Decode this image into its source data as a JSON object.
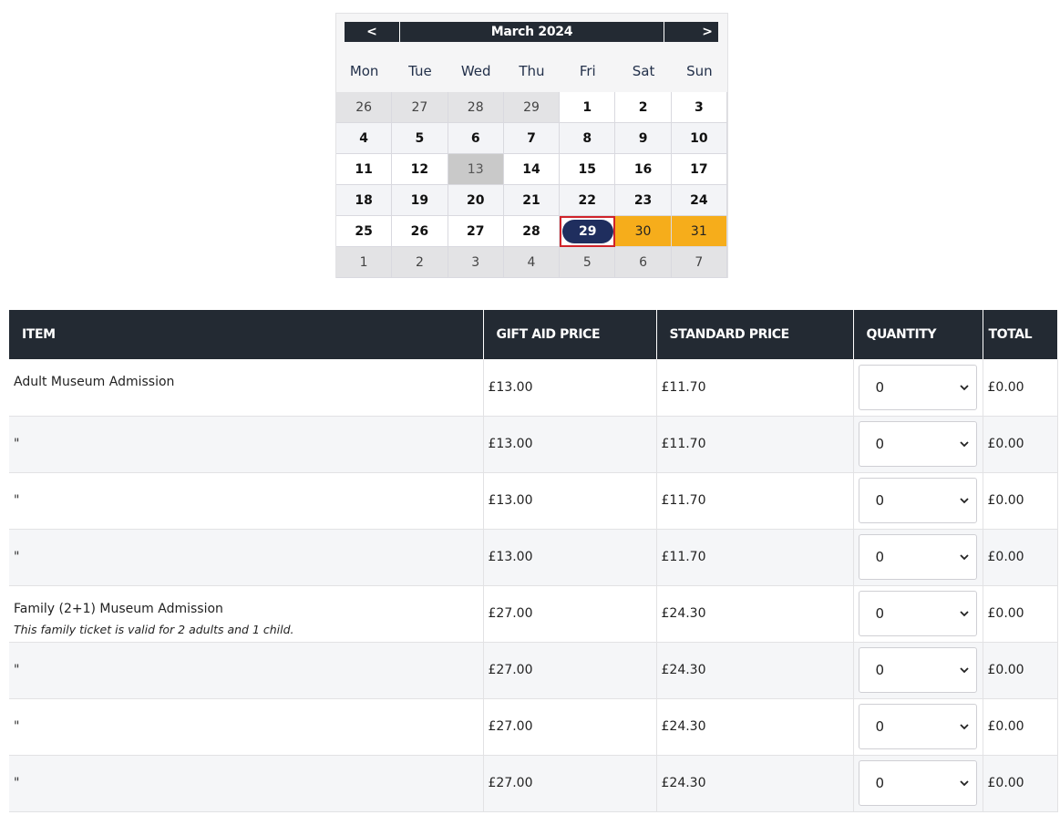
{
  "calendar": {
    "prev_label": "<",
    "next_label": ">",
    "month_title": "March 2024",
    "weekdays": [
      "Mon",
      "Tue",
      "Wed",
      "Thu",
      "Fri",
      "Sat",
      "Sun"
    ],
    "weeks": [
      [
        "26",
        "27",
        "28",
        "29",
        "1",
        "2",
        "3"
      ],
      [
        "4",
        "5",
        "6",
        "7",
        "8",
        "9",
        "10"
      ],
      [
        "11",
        "12",
        "13",
        "14",
        "15",
        "16",
        "17"
      ],
      [
        "18",
        "19",
        "20",
        "21",
        "22",
        "23",
        "24"
      ],
      [
        "25",
        "26",
        "27",
        "28",
        "29",
        "30",
        "31"
      ],
      [
        "1",
        "2",
        "3",
        "4",
        "5",
        "6",
        "7"
      ]
    ],
    "selected_day": "29",
    "available_days": [
      "30",
      "31"
    ],
    "disabled_day": "13"
  },
  "table": {
    "headers": {
      "item": "ITEM",
      "gift_aid": "GIFT AID PRICE",
      "standard": "STANDARD PRICE",
      "quantity": "QUANTITY",
      "total": "TOTAL"
    },
    "rows": [
      {
        "item": "Adult Museum Admission",
        "note": "",
        "gift_aid": "£13.00",
        "standard": "£11.70",
        "qty": "0",
        "total": "£0.00"
      },
      {
        "item": "\"",
        "note": "",
        "gift_aid": "£13.00",
        "standard": "£11.70",
        "qty": "0",
        "total": "£0.00"
      },
      {
        "item": "\"",
        "note": "",
        "gift_aid": "£13.00",
        "standard": "£11.70",
        "qty": "0",
        "total": "£0.00"
      },
      {
        "item": "\"",
        "note": "",
        "gift_aid": "£13.00",
        "standard": "£11.70",
        "qty": "0",
        "total": "£0.00"
      },
      {
        "item": "Family (2+1) Museum Admission",
        "note": "This family ticket is valid for 2 adults and 1 child.",
        "gift_aid": "£27.00",
        "standard": "£24.30",
        "qty": "0",
        "total": "£0.00"
      },
      {
        "item": "\"",
        "note": "",
        "gift_aid": "£27.00",
        "standard": "£24.30",
        "qty": "0",
        "total": "£0.00"
      },
      {
        "item": "\"",
        "note": "",
        "gift_aid": "£27.00",
        "standard": "£24.30",
        "qty": "0",
        "total": "£0.00"
      },
      {
        "item": "\"",
        "note": "",
        "gift_aid": "£27.00",
        "standard": "£24.30",
        "qty": "0",
        "total": "£0.00"
      }
    ]
  },
  "colors": {
    "header_bg": "#232a33",
    "selected_bg": "#1f2e5e",
    "selected_border": "#d0232a",
    "available_bg": "#f6ad1b",
    "disabled_bg": "#c9c9c9"
  }
}
